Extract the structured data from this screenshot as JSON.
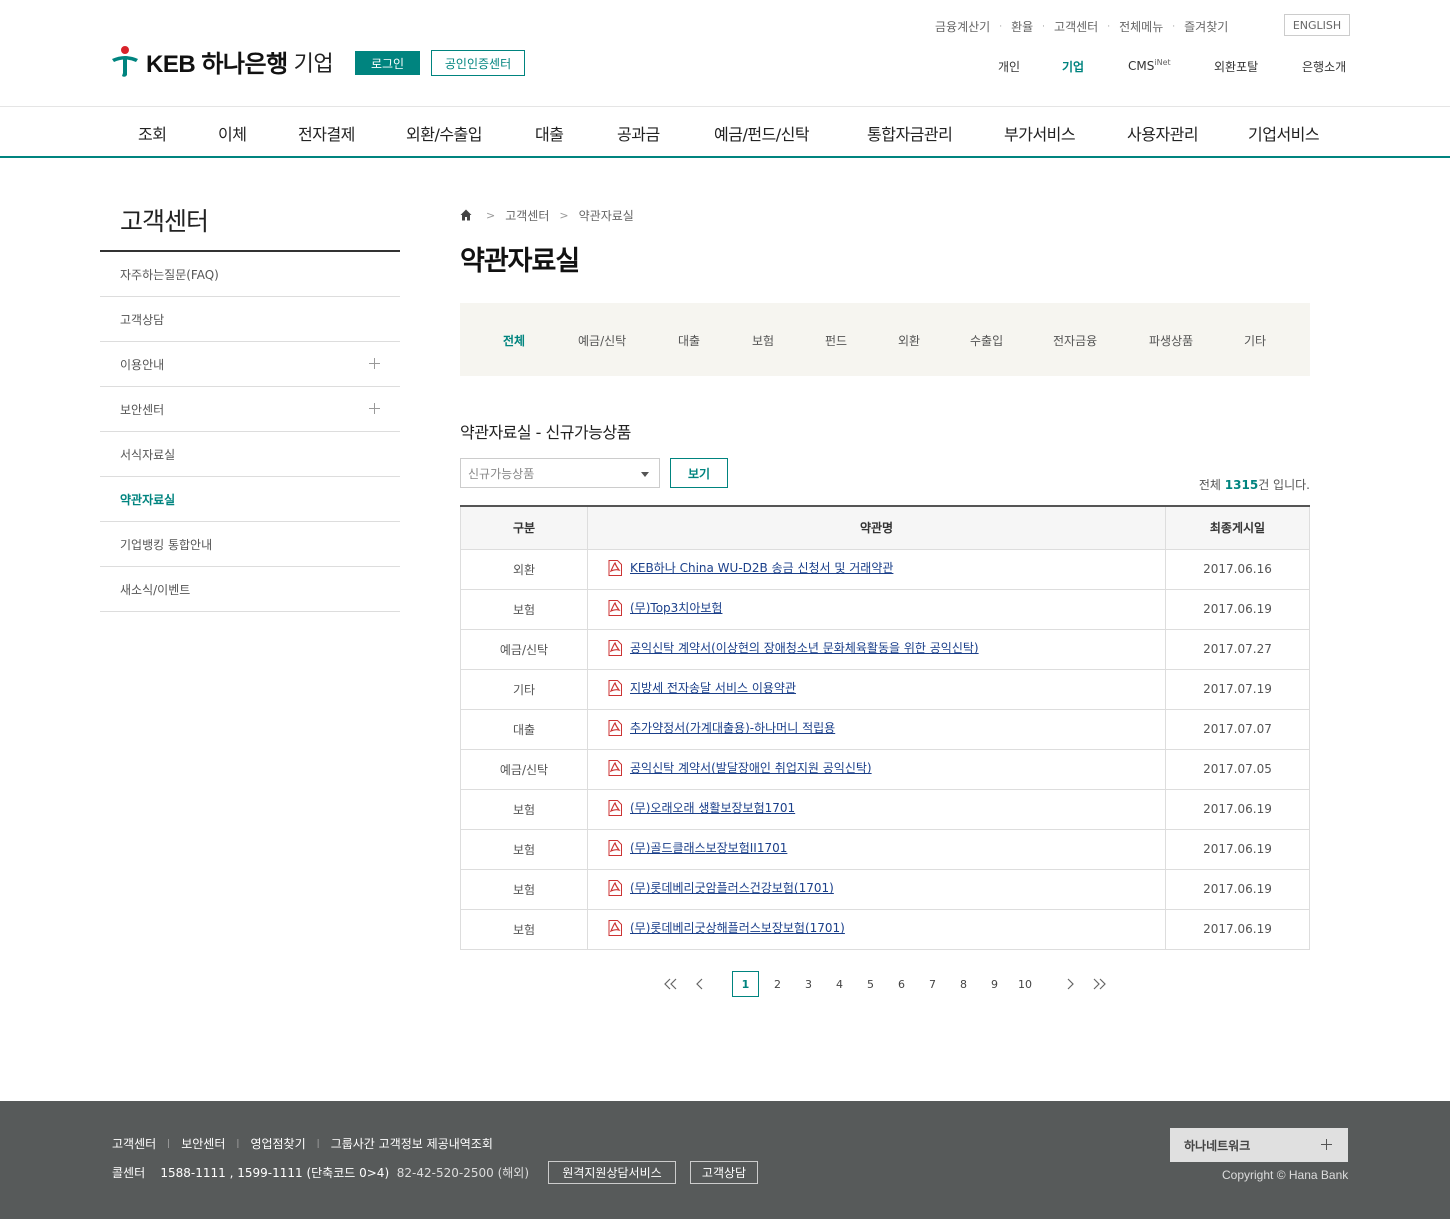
{
  "brand": {
    "name": "KEB 하나은행",
    "section": "기업"
  },
  "header": {
    "login": "로그인",
    "cert": "공인인증센터",
    "util": [
      "금융계산기",
      "환율",
      "고객센터",
      "전체메뉴",
      "즐겨찾기"
    ],
    "english": "ENGLISH",
    "topnav": [
      "개인",
      "기업",
      "CMS",
      "외환포탈",
      "은행소개"
    ],
    "cms_sup": "iNet",
    "active_topnav": "기업"
  },
  "gnb": [
    "조회",
    "이체",
    "전자결제",
    "외환/수출입",
    "대출",
    "공과금",
    "예금/펀드/신탁",
    "통합자금관리",
    "부가서비스",
    "사용자관리",
    "기업서비스"
  ],
  "lnb": {
    "title": "고객센터",
    "items": [
      "자주하는질문(FAQ)",
      "고객상담",
      "이용안내",
      "보안센터",
      "서식자료실",
      "약관자료실",
      "기업뱅킹 통합안내",
      "새소식/이벤트"
    ],
    "active": "약관자료실"
  },
  "breadcrumb": [
    "고객센터",
    "약관자료실"
  ],
  "page_title": "약관자료실",
  "tabs": [
    "전체",
    "예금/신탁",
    "대출",
    "보험",
    "펀드",
    "외환",
    "수출입",
    "전자금융",
    "파생상품",
    "기타"
  ],
  "active_tab": "전체",
  "sub_title": "약관자료실 - 신규가능상품",
  "filter": {
    "selected": "신규가능상품",
    "view_button": "보기"
  },
  "count": {
    "prefix": "전체",
    "total": "1315",
    "suffix": "건 입니다."
  },
  "table": {
    "headers": [
      "구분",
      "약관명",
      "최종게시일"
    ],
    "rows": [
      {
        "category": "외환",
        "title": "KEB하나 China WU-D2B 송금 신청서 및 거래약관",
        "date": "2017.06.16"
      },
      {
        "category": "보험",
        "title": "(무)Top3치아보험",
        "date": "2017.06.19"
      },
      {
        "category": "예금/신탁",
        "title": "공익신탁 계약서(이상현의 장애청소년 문화체육활동을 위한 공익신탁)",
        "date": "2017.07.27"
      },
      {
        "category": "기타",
        "title": "지방세 전자송달 서비스 이용약관",
        "date": "2017.07.19"
      },
      {
        "category": "대출",
        "title": "추가약정서(가계대출용)-하나머니 적립용",
        "date": "2017.07.07"
      },
      {
        "category": "예금/신탁",
        "title": "공익신탁 계약서(발달장애인 취업지원 공익신탁)",
        "date": "2017.07.05"
      },
      {
        "category": "보험",
        "title": "(무)오래오래 생활보장보험1701",
        "date": "2017.06.19"
      },
      {
        "category": "보험",
        "title": "(무)골드클래스보장보험II1701",
        "date": "2017.06.19"
      },
      {
        "category": "보험",
        "title": "(무)롯데베리굿암플러스건강보험(1701)",
        "date": "2017.06.19"
      },
      {
        "category": "보험",
        "title": "(무)롯데베리굿상해플러스보장보험(1701)",
        "date": "2017.06.19"
      }
    ]
  },
  "pager": {
    "pages": [
      "1",
      "2",
      "3",
      "4",
      "5",
      "6",
      "7",
      "8",
      "9",
      "10"
    ],
    "current": "1"
  },
  "footer": {
    "links": [
      "고객센터",
      "보안센터",
      "영업점찾기",
      "그룹사간 고객정보 제공내역조회"
    ],
    "call_label": "콜센터",
    "call_numbers": "1588-1111 , 1599-1111 (단축코드 0>4)",
    "overseas": "82-42-520-2500 (해외)",
    "remote": "원격지원상담서비스",
    "consult": "고객상담",
    "hananet": "하나네트워크",
    "copyright": "Copyright © Hana Bank"
  },
  "colors": {
    "accent": "#00847f",
    "link": "#1a3f8a",
    "footer_bg": "#575a5a",
    "tab_bg": "#f6f5f0"
  }
}
